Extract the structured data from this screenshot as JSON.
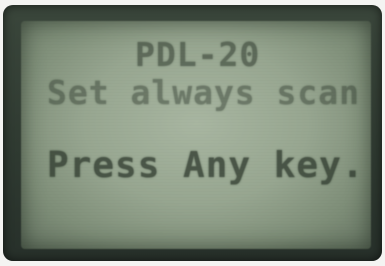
{
  "display": {
    "line1": "PDL-20",
    "line2": "Set always scan",
    "line3": "Press Any key."
  }
}
